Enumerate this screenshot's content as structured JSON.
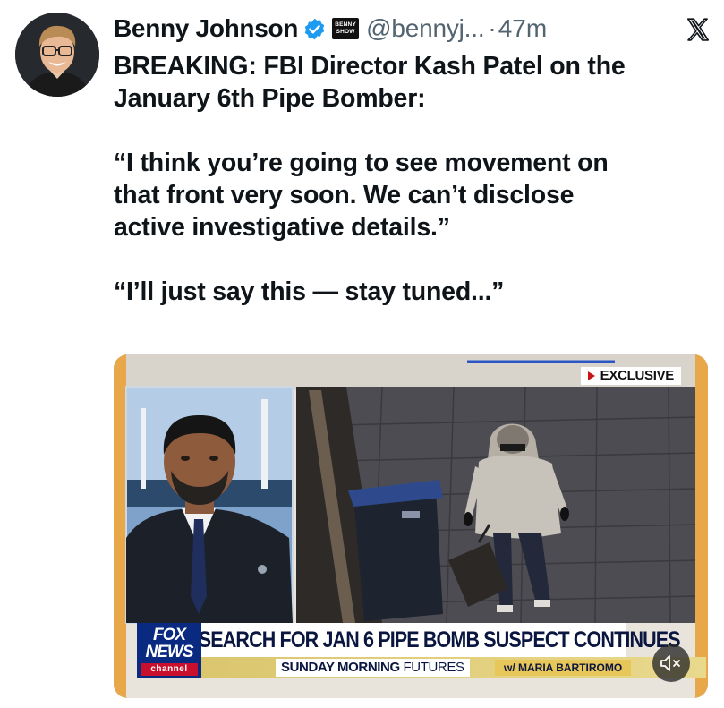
{
  "post": {
    "author_name": "Benny Johnson",
    "show_badge_line1": "BENNY",
    "show_badge_line2": "SHOW",
    "handle": "@bennyj...",
    "separator": "·",
    "time": "47m",
    "lines": [
      "BREAKING: FBI Director Kash Patel on the",
      "January 6th Pipe Bomber:",
      "",
      "“I think you’re going to see movement on",
      "that front very soon. We can’t disclose",
      "active investigative details.”",
      "",
      "“I’ll just say this — stay tuned...”"
    ]
  },
  "icons": {
    "verified": "verified-badge-icon",
    "platform": "x-logo-icon",
    "mute": "speaker-muted-icon"
  },
  "video": {
    "exclusive_label": "EXCLUSIVE",
    "chyron": "SEARCH FOR JAN 6 PIPE BOMB SUSPECT CONTINUES",
    "show_name_bold": "SUNDAY MORNING",
    "show_name_light": "FUTURES",
    "host": "w/ MARIA BARTIROMO",
    "network_line1": "FOX",
    "network_line2": "NEWS",
    "network_line3": "channel"
  },
  "colors": {
    "verified_blue": "#1d9bf0",
    "secondary_text": "#536471",
    "fox_blue": "#0a2a82",
    "fox_red": "#c8102e"
  }
}
